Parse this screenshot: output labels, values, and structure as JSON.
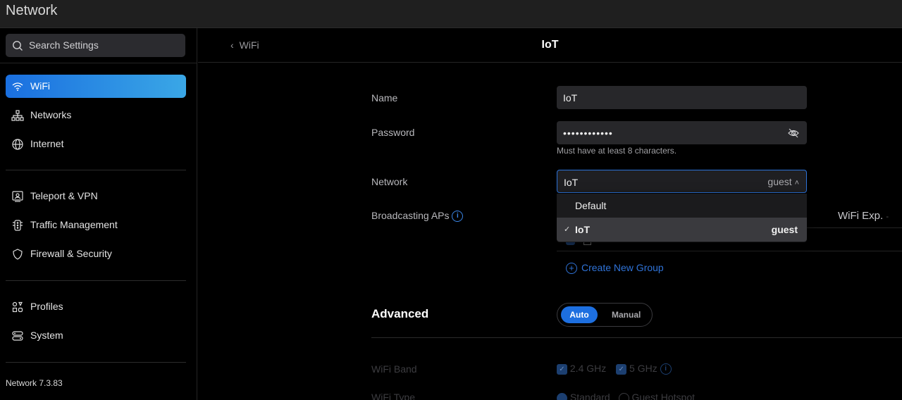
{
  "titlebar": {
    "title": "Network"
  },
  "sidebar": {
    "search_placeholder": "Search Settings",
    "items": [
      {
        "label": "WiFi",
        "icon": "wifi-icon"
      },
      {
        "label": "Networks",
        "icon": "network-tree-icon"
      },
      {
        "label": "Internet",
        "icon": "globe-icon"
      },
      {
        "label": "Teleport & VPN",
        "icon": "teleport-icon"
      },
      {
        "label": "Traffic Management",
        "icon": "traffic-icon"
      },
      {
        "label": "Firewall & Security",
        "icon": "shield-icon"
      },
      {
        "label": "Profiles",
        "icon": "profiles-icon"
      },
      {
        "label": "System",
        "icon": "system-icon"
      }
    ],
    "version": "Network 7.3.83"
  },
  "header": {
    "back_label": "WiFi",
    "title": "IoT"
  },
  "form": {
    "name_label": "Name",
    "name_value": "IoT",
    "password_label": "Password",
    "password_value": "••••••••••••",
    "password_hint": "Must have at least 8 characters.",
    "network_label": "Network",
    "network_value": "IoT",
    "network_tag": "guest",
    "network_options": [
      {
        "label": "Default",
        "tag": ""
      },
      {
        "label": "IoT",
        "tag": "guest",
        "selected": true
      }
    ],
    "broadcasting_label": "Broadcasting APs",
    "wifi_exp_label": "WiFi Exp.",
    "create_group_label": "Create New Group",
    "advanced_label": "Advanced",
    "mode_auto": "Auto",
    "mode_manual": "Manual",
    "wifi_band_label": "WiFi Band",
    "band_24": "2.4 GHz",
    "band_5": "5 GHz",
    "wifi_type_label": "WiFi Type",
    "type_standard": "Standard",
    "type_guest": "Guest Hotspot"
  },
  "colors": {
    "accent": "#1d6fe0",
    "link": "#2f73d8",
    "background": "#000000"
  }
}
